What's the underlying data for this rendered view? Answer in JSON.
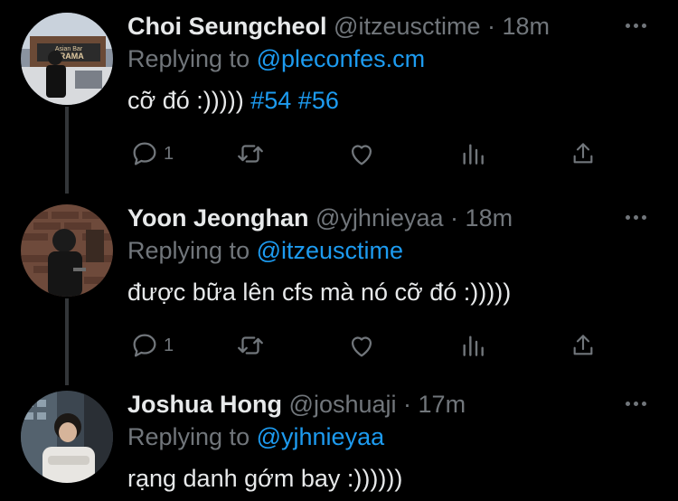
{
  "tweets": [
    {
      "name": "Choi Seungcheol",
      "handle": "@itzeusctime",
      "separator": "·",
      "time": "18m",
      "replying_prefix": "Replying to",
      "replying_to": "@pleconfes.cm",
      "text": "cỡ đó :)))))",
      "hashtags": [
        "#54",
        "#56"
      ],
      "reply_count": "1",
      "avatar_sign_text": [
        "Asian Bar",
        "DRAMA"
      ]
    },
    {
      "name": "Yoon Jeonghan",
      "handle": "@yjhnieyaa",
      "separator": "·",
      "time": "18m",
      "replying_prefix": "Replying to",
      "replying_to": "@itzeusctime",
      "text": "được bữa lên cfs mà nó cỡ đó :)))))",
      "reply_count": "1"
    },
    {
      "name": "Joshua Hong",
      "handle": "@joshuaji",
      "separator": "·",
      "time": "17m",
      "replying_prefix": "Replying to",
      "replying_to": "@yjhnieyaa",
      "text": "rạng danh gớm bay :))))))"
    }
  ],
  "icons": {
    "reply": "reply-icon",
    "retweet": "retweet-icon",
    "like": "heart-icon",
    "analytics": "analytics-icon",
    "share": "share-icon",
    "more": "more-icon"
  },
  "colors": {
    "background": "#000000",
    "text": "#e7e9ea",
    "muted": "#71767b",
    "link": "#1d9bf0",
    "thread_line": "#333639"
  }
}
